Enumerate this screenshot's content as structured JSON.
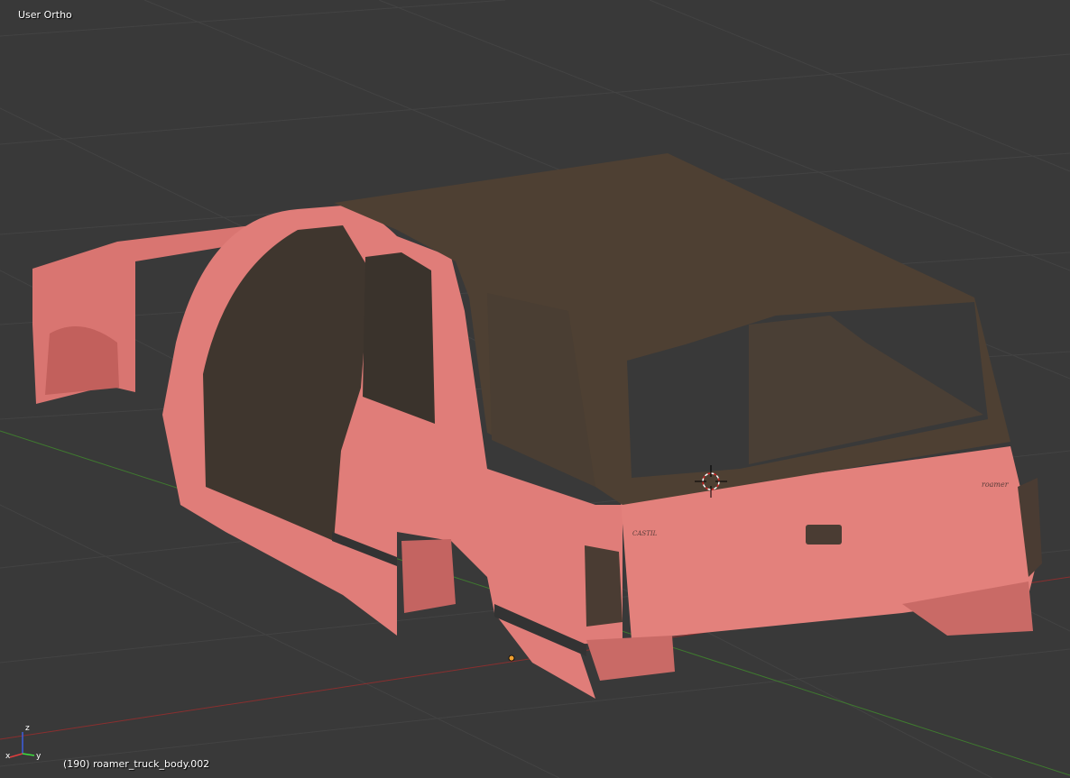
{
  "viewport": {
    "view_name": "User Ortho",
    "object_info": "(190) roamer_truck_body.002"
  },
  "model": {
    "rear_badge_left": "CASTIL",
    "rear_badge_right": "roamer"
  },
  "axis_gizmo": {
    "x_label": "x",
    "y_label": "y",
    "z_label": "z"
  },
  "colors": {
    "background": "#393939",
    "grid_line": "#434343",
    "x_axis": "#8a2f2f",
    "y_axis": "#3f7a2f",
    "body_paint": "#e07d79",
    "roof": "#4e4033",
    "interior": "#3f362e",
    "tail_light": "#4a3c33"
  }
}
